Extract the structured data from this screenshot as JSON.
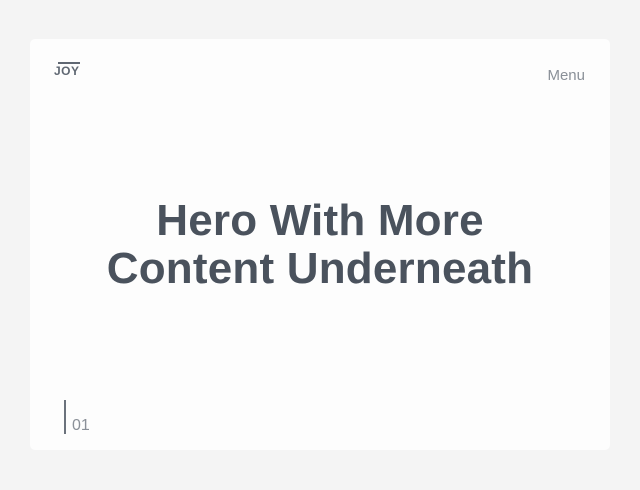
{
  "brand": {
    "logo_text": "JOY"
  },
  "nav": {
    "menu_label": "Menu"
  },
  "hero": {
    "title_line1": "Hero With More",
    "title_line2": "Content Underneath"
  },
  "slider": {
    "current_index": "01"
  },
  "colors": {
    "page_background": "#f4f4f4",
    "card_background": "#fdfdfd",
    "title_text": "#4a525d",
    "muted_text": "#8a9098"
  }
}
